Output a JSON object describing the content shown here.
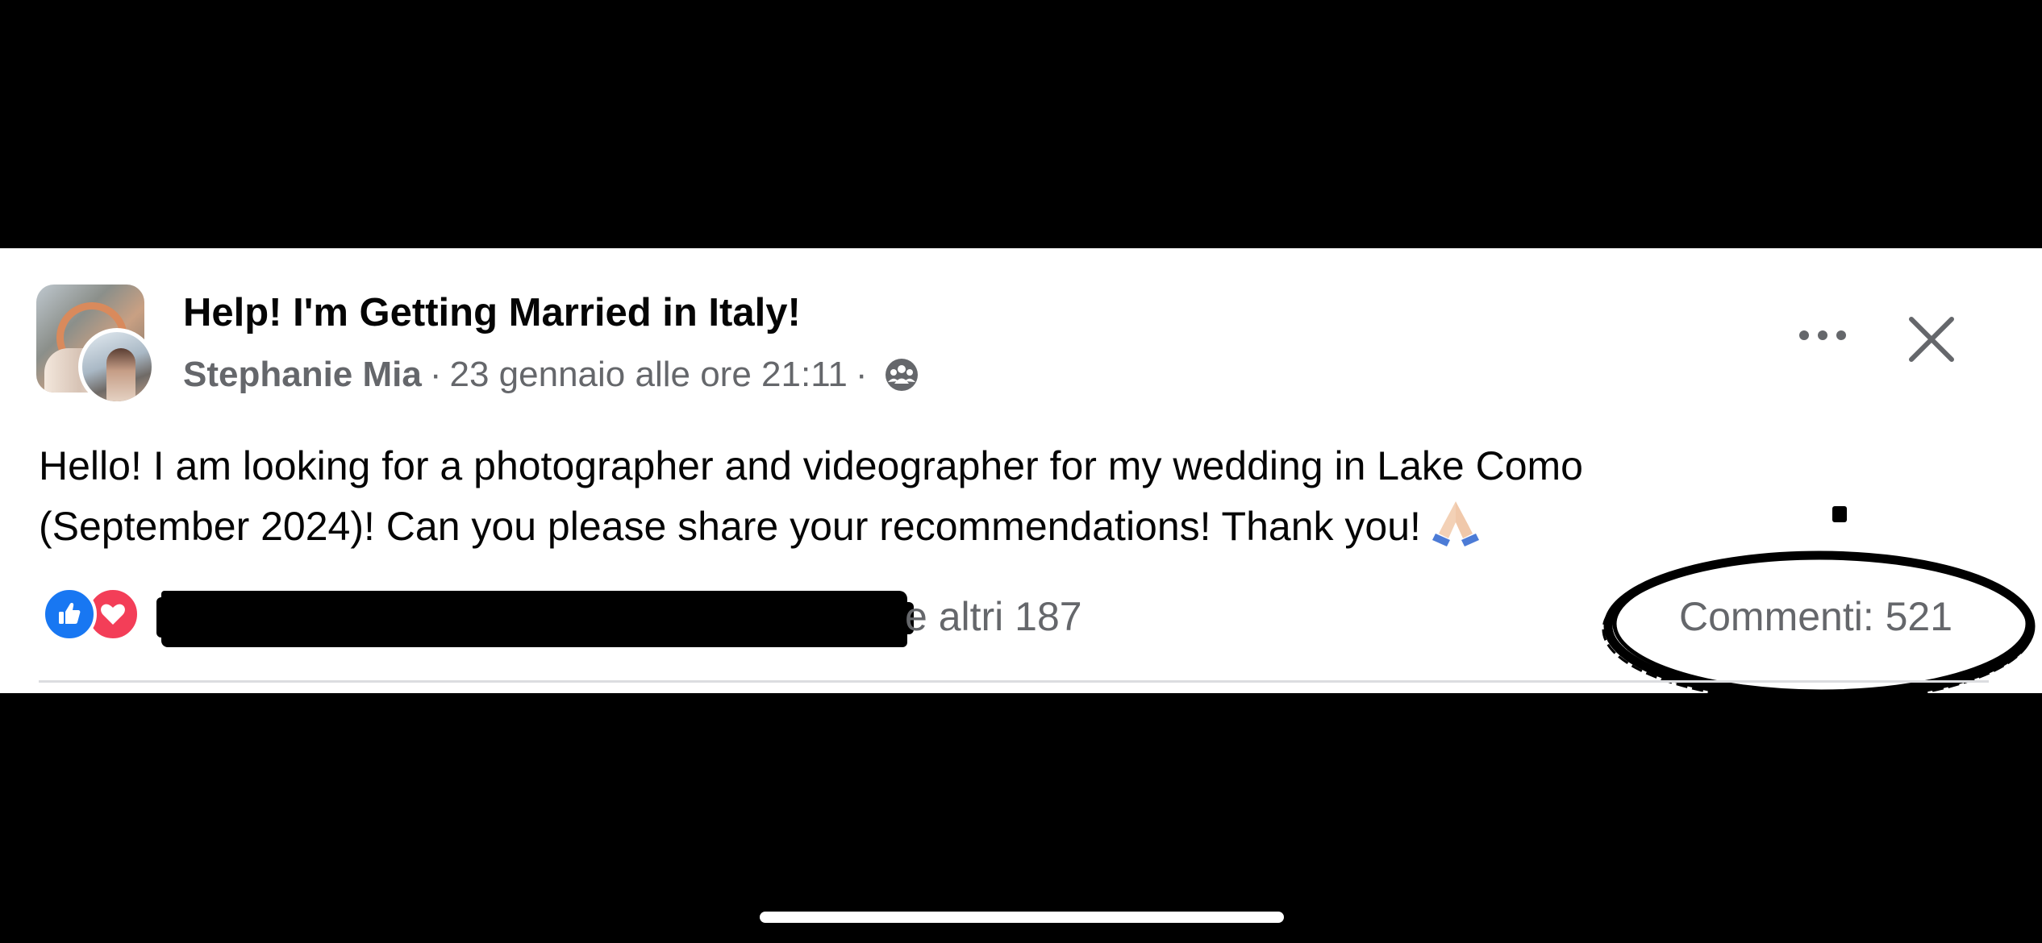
{
  "post": {
    "group_name": "Help! I'm Getting Married in Italy!",
    "author": "Stephanie Mia",
    "separator": "·",
    "timestamp": "23 gennaio alle ore 21:11",
    "audience_icon": "group-audience-icon",
    "text_line1": "Hello! I am looking for a photographer and videographer for my wedding in Lake Como",
    "text_line2": "(September 2024)! Can you please share your recommendations! Thank you!",
    "emoji": "folded-hands-emoji"
  },
  "actions": {
    "more_icon": "more-dots-icon",
    "close_icon": "close-icon"
  },
  "engagement": {
    "reaction_icons": [
      "like-icon",
      "love-icon"
    ],
    "others_text": "e altri 187",
    "comments_text": "Commenti: 521"
  },
  "colors": {
    "like": "#1877f2",
    "love": "#f33e58",
    "secondary_text": "#65676b",
    "primary_text": "#050505"
  }
}
